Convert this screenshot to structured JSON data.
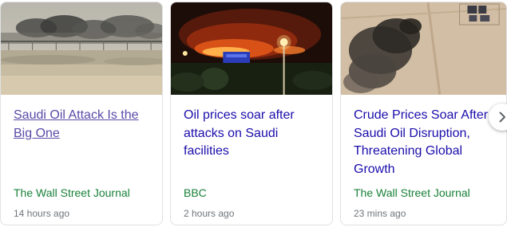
{
  "cards": [
    {
      "headline": "Saudi Oil Attack Is the Big One",
      "source": "The Wall Street Journal",
      "time": "14 hours ago",
      "thumbnail": "smoke-over-desert-fence-photo"
    },
    {
      "headline": "Oil prices soar after attacks on Saudi facilities",
      "source": "BBC",
      "time": "2 hours ago",
      "thumbnail": "night-fire-oil-facility-photo"
    },
    {
      "headline": "Crude Prices Soar After Saudi Oil Disruption, Threatening Global Growth",
      "source": "The Wall Street Journal",
      "time": "23 mins ago",
      "thumbnail": "satellite-smoke-plume-photo"
    }
  ],
  "controls": {
    "next_icon": "chevron-right-icon"
  },
  "colors": {
    "link": "#1a0dab",
    "visited_link": "#5a4aa8",
    "source": "#188038",
    "time": "#70757a",
    "border": "#dfe1e5"
  }
}
